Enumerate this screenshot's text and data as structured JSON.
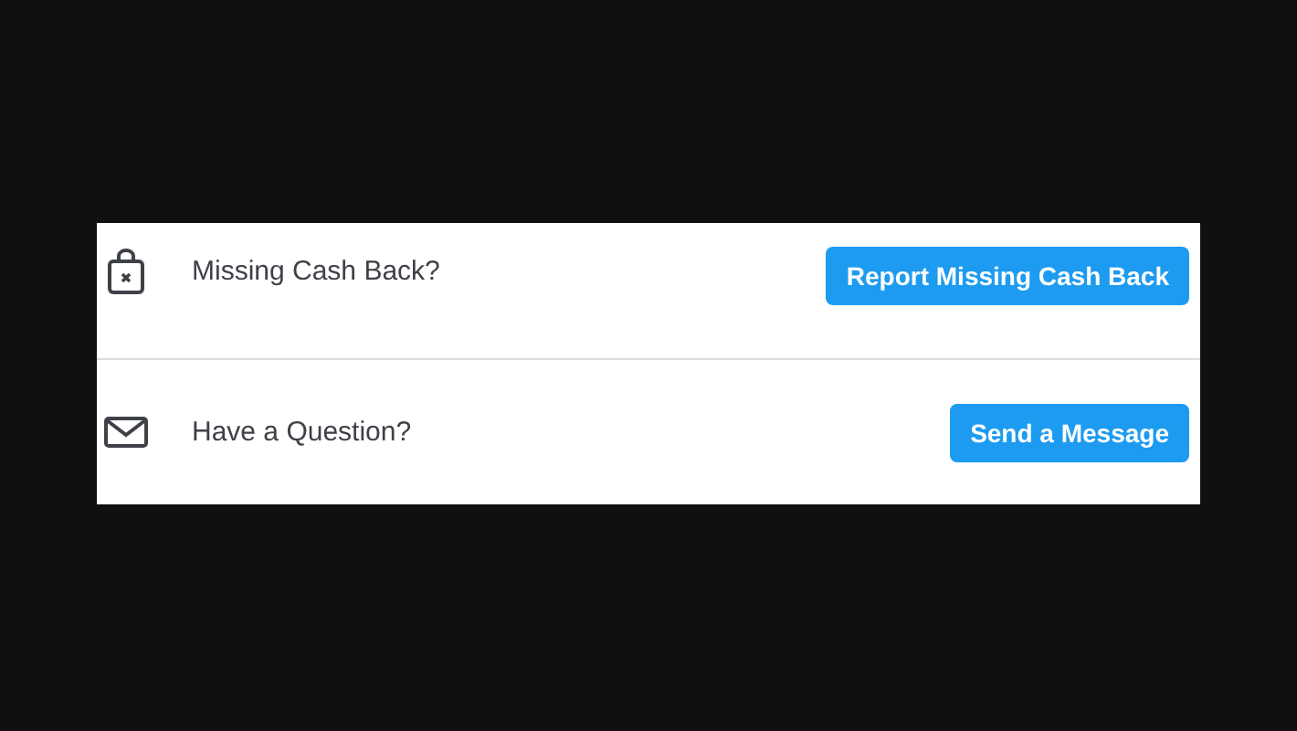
{
  "rows": [
    {
      "kind": "bag",
      "label": "Missing Cash Back?",
      "button": "Report Missing Cash Back"
    },
    {
      "kind": "envelope",
      "label": "Have a Question?",
      "button": "Send a Message"
    }
  ]
}
